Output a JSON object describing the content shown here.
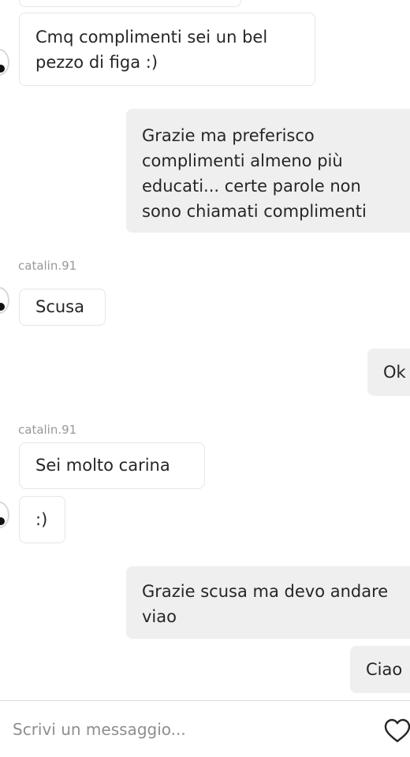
{
  "messages": [
    {
      "sender": "",
      "text": "Cmq complimenti sei un bel pezzo di figa :)"
    },
    {
      "sender": "me",
      "text": "Grazie ma preferisco complimenti almeno più educati... certe parole non sono chiamati complimenti"
    },
    {
      "sender": "catalin.91",
      "text": "Scusa"
    },
    {
      "sender": "me",
      "text": "Ok"
    },
    {
      "sender": "catalin.91",
      "text": "Sei molto carina"
    },
    {
      "sender": "",
      "text": ":)"
    },
    {
      "sender": "me",
      "text": "Grazie  scusa ma devo andare viao"
    },
    {
      "sender": "me",
      "text": "Ciao"
    }
  ],
  "composer": {
    "placeholder": "Scrivi un messaggio...",
    "like_icon": "heart-icon"
  }
}
